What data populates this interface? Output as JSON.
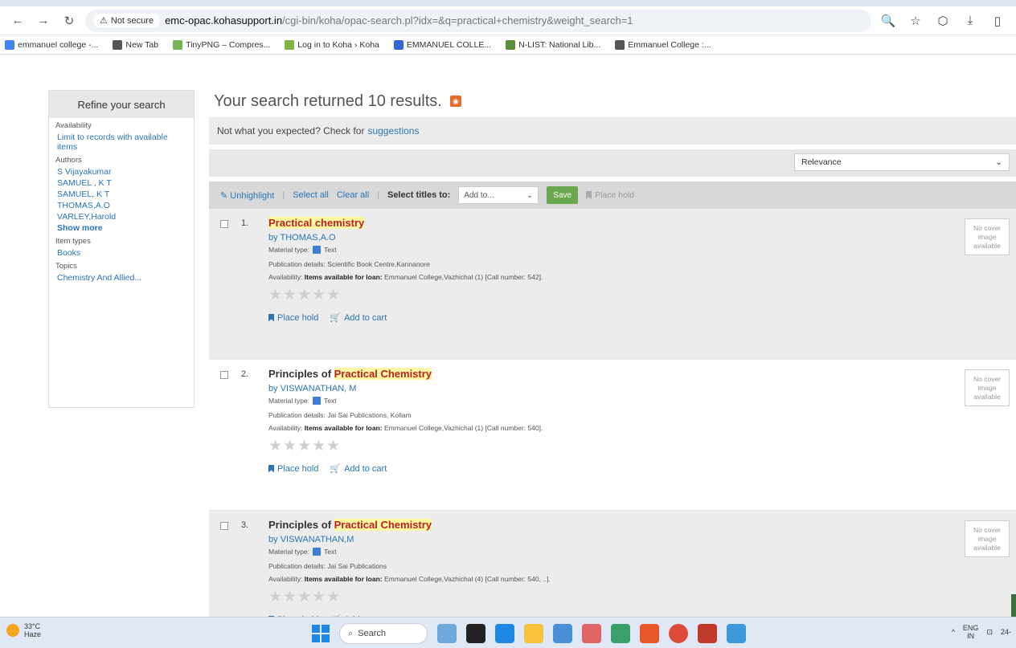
{
  "browser": {
    "security": "Not secure",
    "url_host": "emc-opac.kohasupport.in",
    "url_path": "/cgi-bin/koha/opac-search.pl?idx=&q=practical+chemistry&weight_search=1",
    "bookmarks": [
      {
        "label": "emmanuel college -...",
        "color": "#4285f4"
      },
      {
        "label": "New Tab",
        "color": "#555555"
      },
      {
        "label": "TinyPNG – Compres...",
        "color": "#77b255"
      },
      {
        "label": "Log in to Koha › Koha",
        "color": "#7cb342"
      },
      {
        "label": "EMMANUEL COLLE...",
        "color": "#3367d6"
      },
      {
        "label": "N-LIST: National Lib...",
        "color": "#5b8f3c"
      },
      {
        "label": "Emmanuel College :...",
        "color": "#555555"
      }
    ]
  },
  "sidebar": {
    "title": "Refine your search",
    "availability_head": "Availability",
    "availability_link": "Limit to records with available items",
    "authors_head": "Authors",
    "authors": [
      "S Vijayakumar",
      "SAMUEL , K T",
      "SAMUEL, K T",
      "THOMAS,A.O",
      "VARLEY,Harold"
    ],
    "show_more": "Show more",
    "item_types_head": "Item types",
    "item_types": [
      "Books"
    ],
    "topics_head": "Topics",
    "topics": [
      "Chemistry And Allied..."
    ]
  },
  "main": {
    "results_title": "Your search returned 10 results.",
    "suggest_text": "Not what you expected? Check for",
    "suggest_link": "suggestions",
    "sort_value": "Relevance",
    "unhighlight": "Unhighlight",
    "select_all": "Select all",
    "clear_all": "Clear all",
    "select_titles_to": "Select titles to:",
    "add_to": "Add to...",
    "save": "Save",
    "place_hold": "Place hold"
  },
  "results": [
    {
      "num": "1.",
      "title_parts": [
        {
          "text": "Practical chemistry",
          "hl": true
        }
      ],
      "author": "THOMAS,A.O",
      "material_label": "Material type:",
      "material": "Text",
      "pub_label": "Publication details:",
      "pub": "Scientific Book Centre,Kannanore",
      "avail_label": "Availability:",
      "avail_bold": "Items available for loan:",
      "avail_rest": "Emmanuel College,Vazhichal (1) [Call number: 542].",
      "place_hold": "Place hold",
      "add_to_cart": "Add to cart",
      "cover": "No cover image available"
    },
    {
      "num": "2.",
      "title_parts": [
        {
          "text": "Principles of ",
          "hl": false
        },
        {
          "text": "Practical Chemistry",
          "hl": true
        }
      ],
      "author": "VISWANATHAN, M",
      "material_label": "Material type:",
      "material": "Text",
      "pub_label": "Publication details:",
      "pub": "Jai Sai Publications, Kollam",
      "avail_label": "Availability:",
      "avail_bold": "Items available for loan:",
      "avail_rest": "Emmanuel College,Vazhichal (1) [Call number: 540].",
      "place_hold": "Place hold",
      "add_to_cart": "Add to cart",
      "cover": "No cover image available"
    },
    {
      "num": "3.",
      "title_parts": [
        {
          "text": "Principles of ",
          "hl": false
        },
        {
          "text": "Practical Chemistry",
          "hl": true
        }
      ],
      "author": "VISWANATHAN,M",
      "material_label": "Material type:",
      "material": "Text",
      "pub_label": "Publication details:",
      "pub": "Jai Sai Publications",
      "avail_label": "Availability:",
      "avail_bold": "Items available for loan:",
      "avail_rest": "Emmanuel College,Vazhichal (4) [Call number: 540, ..].",
      "place_hold": "Place hold",
      "add_to_cart": "Add to cart",
      "cover": "No cover image available"
    }
  ],
  "taskbar": {
    "temp": "33°C",
    "weather": "Haze",
    "search": "Search",
    "lang1": "ENG",
    "lang2": "IN",
    "clock": "24-"
  }
}
